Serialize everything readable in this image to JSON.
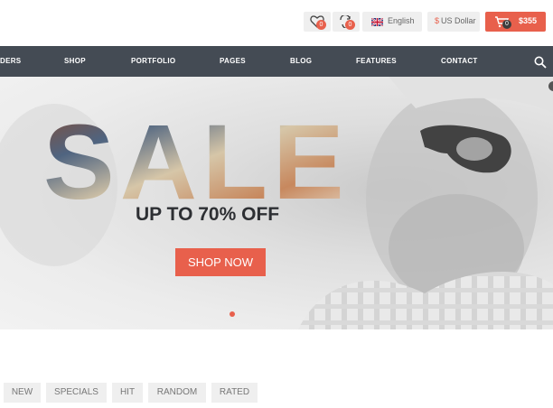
{
  "header": {
    "wishlist_count": "0",
    "compare_count": "0",
    "language": "English",
    "currency_symbol": "$",
    "currency": "US Dollar",
    "cart_count": "0",
    "cart_total": "$355",
    "accent_color": "#e8604c"
  },
  "nav": {
    "items": [
      "DERS",
      "SHOP",
      "PORTFOLIO",
      "PAGES",
      "BLOG",
      "FEATURES",
      "CONTACT"
    ]
  },
  "hero": {
    "headline": "SALE",
    "subheadline": "UP TO 70% OFF",
    "cta": "SHOP NOW"
  },
  "tabs": [
    "NEW",
    "SPECIALS",
    "HIT",
    "RANDOM",
    "RATED"
  ]
}
